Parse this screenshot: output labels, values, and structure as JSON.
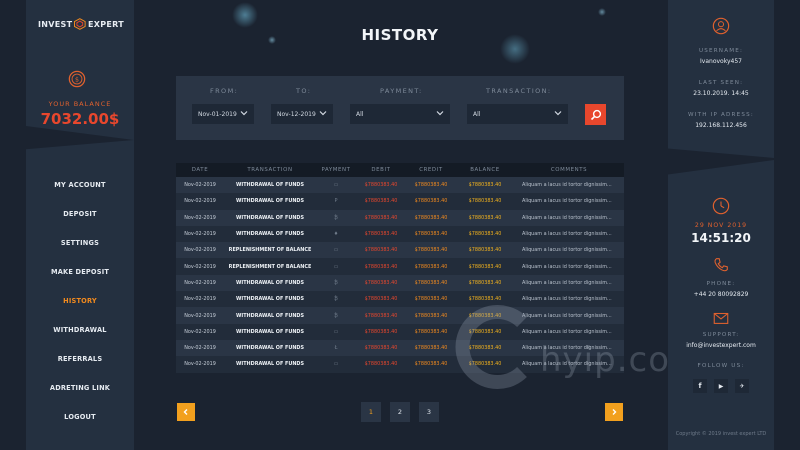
{
  "brand": {
    "left": "INVEST",
    "right": "EXPERT"
  },
  "balance": {
    "label": "YOUR BALANCE",
    "value": "7032.00$"
  },
  "nav": [
    {
      "label": "MY ACCOUNT",
      "active": false
    },
    {
      "label": "DEPOSIT",
      "active": false
    },
    {
      "label": "SETTINGS",
      "active": false
    },
    {
      "label": "MAKE DEPOSIT",
      "active": false
    },
    {
      "label": "HISTORY",
      "active": true
    },
    {
      "label": "WITHDRAWAL",
      "active": false
    },
    {
      "label": "REFERRALS",
      "active": false
    },
    {
      "label": "ADRETING LINK",
      "active": false
    },
    {
      "label": "LOGOUT",
      "active": false
    }
  ],
  "page": {
    "title": "HISTORY"
  },
  "filters": {
    "from": {
      "label": "FROM:",
      "value": "Nov-01-2019"
    },
    "to": {
      "label": "TO:",
      "value": "Nov-12-2019"
    },
    "payment": {
      "label": "PAYMENT:",
      "value": "All"
    },
    "transaction": {
      "label": "TRANSACTION:",
      "value": "All"
    }
  },
  "table": {
    "headers": [
      "DATE",
      "TRANSACTION",
      "PAYMENT",
      "DEBIT",
      "CREDIT",
      "BALANCE",
      "COMMENTS"
    ],
    "rows": [
      {
        "date": "Nov-02-2019",
        "transaction": "WITHDRAWAL OF FUNDS",
        "payment": "▭",
        "debit": "$7880383.40",
        "credit": "$7880383.40",
        "balance": "$7880383.40",
        "comments": "Aliquam a lacus id tortor dignissim..."
      },
      {
        "date": "Nov-02-2019",
        "transaction": "WITHDRAWAL OF FUNDS",
        "payment": "P",
        "debit": "$7880383.40",
        "credit": "$7880383.40",
        "balance": "$7880383.40",
        "comments": "Aliquam a lacus id tortor dignissim..."
      },
      {
        "date": "Nov-02-2019",
        "transaction": "WITHDRAWAL OF FUNDS",
        "payment": "₿",
        "debit": "$7880383.40",
        "credit": "$7880383.40",
        "balance": "$7880383.40",
        "comments": "Aliquam a lacus id tortor dignissim..."
      },
      {
        "date": "Nov-02-2019",
        "transaction": "WITHDRAWAL OF FUNDS",
        "payment": "♦",
        "debit": "$7880383.40",
        "credit": "$7880383.40",
        "balance": "$7880383.40",
        "comments": "Aliquam a lacus id tortor dignissim..."
      },
      {
        "date": "Nov-02-2019",
        "transaction": "REPLENISHMENT OF BALANCE",
        "payment": "▭",
        "debit": "$7880383.40",
        "credit": "$7880383.40",
        "balance": "$7880383.40",
        "comments": "Aliquam a lacus id tortor dignissim..."
      },
      {
        "date": "Nov-02-2019",
        "transaction": "REPLENISHMENT OF BALANCE",
        "payment": "▭",
        "debit": "$7880383.40",
        "credit": "$7880383.40",
        "balance": "$7880383.40",
        "comments": "Aliquam a lacus id tortor dignissim..."
      },
      {
        "date": "Nov-02-2019",
        "transaction": "WITHDRAWAL OF FUNDS",
        "payment": "₿",
        "debit": "$7880383.40",
        "credit": "$7880383.40",
        "balance": "$7880383.40",
        "comments": "Aliquam a lacus id tortor dignissim..."
      },
      {
        "date": "Nov-02-2019",
        "transaction": "WITHDRAWAL OF FUNDS",
        "payment": "₿",
        "debit": "$7880383.40",
        "credit": "$7880383.40",
        "balance": "$7880383.40",
        "comments": "Aliquam a lacus id tortor dignissim..."
      },
      {
        "date": "Nov-02-2019",
        "transaction": "WITHDRAWAL OF FUNDS",
        "payment": "₿",
        "debit": "$7880383.40",
        "credit": "$7880383.40",
        "balance": "$7880383.40",
        "comments": "Aliquam a lacus id tortor dignissim..."
      },
      {
        "date": "Nov-02-2019",
        "transaction": "WITHDRAWAL OF FUNDS",
        "payment": "▭",
        "debit": "$7880383.40",
        "credit": "$7880383.40",
        "balance": "$7880383.40",
        "comments": "Aliquam a lacus id tortor dignissim..."
      },
      {
        "date": "Nov-02-2019",
        "transaction": "WITHDRAWAL OF FUNDS",
        "payment": "Ł",
        "debit": "$7880383.40",
        "credit": "$7880383.40",
        "balance": "$7880383.40",
        "comments": "Aliquam a lacus id tortor dignissim..."
      },
      {
        "date": "Nov-02-2019",
        "transaction": "WITHDRAWAL OF FUNDS",
        "payment": "▭",
        "debit": "$7880383.40",
        "credit": "$7880383.40",
        "balance": "$7880383.40",
        "comments": "Aliquam a lacus id tortor dignissim..."
      }
    ]
  },
  "pagination": {
    "pages": [
      "1",
      "2",
      "3"
    ],
    "current": "1"
  },
  "account": {
    "username_label": "USERNAME:",
    "username": "Ivanovoky457",
    "last_seen_label": "LAST SEEN:",
    "last_seen": "23.10.2019. 14:45",
    "ip_label": "WITH IP ADRESS:",
    "ip": "192.168.112.456"
  },
  "clock": {
    "date": "29 NOV 2019",
    "time": "14:51:20"
  },
  "contact": {
    "phone_label": "PHONE:",
    "phone": "+44 20 80092829",
    "support_label": "SUPPORT:",
    "support_email": "info@investexpert.com",
    "follow_label": "FOLLOW US:"
  },
  "social": [
    "f",
    "▶",
    "✈"
  ],
  "copyright": "Copyright © 2019 invest expert LTD",
  "watermark": "hyip.com",
  "colors": {
    "accent_red": "#e8472d",
    "accent_orange": "#f28a1e",
    "accent_yellow": "#f2b21e",
    "panel": "#243040",
    "background": "#1b2330"
  },
  "icons": [
    "logo-cube-icon",
    "coin-icon",
    "user-icon",
    "clock-icon",
    "phone-icon",
    "mail-icon",
    "search-icon",
    "chevron-down-icon",
    "arrow-left-icon",
    "arrow-right-icon"
  ]
}
